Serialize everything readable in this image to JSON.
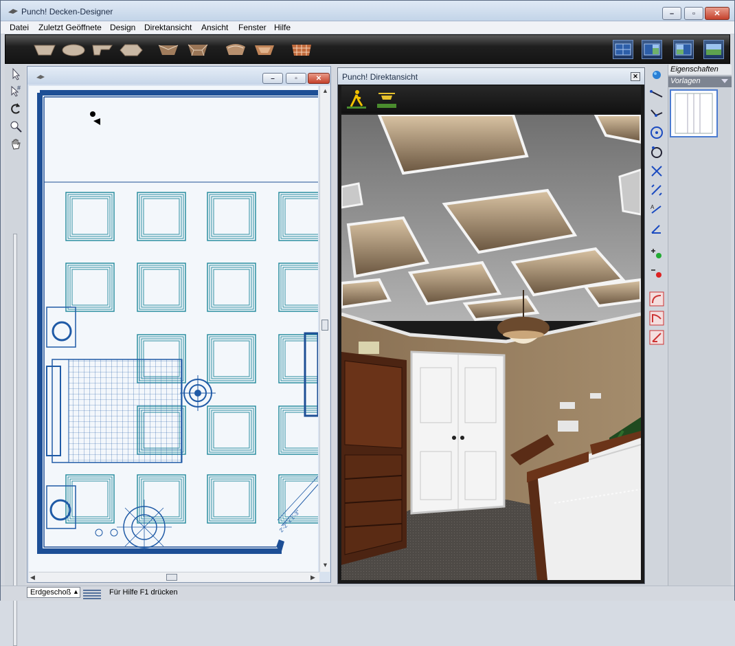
{
  "app": {
    "title": "Punch! Decken-Designer",
    "window_controls": {
      "minimize": "–",
      "maximize": "▫",
      "close": "✕"
    }
  },
  "menu": [
    "Datei",
    "Zuletzt Geöffnete",
    "Design",
    "Direktansicht",
    "Ansicht",
    "Fenster",
    "Hilfe"
  ],
  "toolbar": {
    "ceiling_tools": [
      "tray-ceiling-icon",
      "dome-ceiling-icon",
      "step-ceiling-icon",
      "hex-ceiling-icon",
      "pyramid-ceiling-icon",
      "hip-ceiling-icon",
      "barrel-ceiling-icon",
      "octagon-ceiling-icon",
      "coffer-grid-icon"
    ],
    "view_modes": [
      "plan-view-icon",
      "plan-3d-split-icon",
      "3d-plan-split-icon",
      "3d-view-icon"
    ]
  },
  "left_tools": [
    "select-arrow-icon",
    "select-grid-icon",
    "rotate-icon",
    "zoom-icon",
    "pan-hand-icon"
  ],
  "plan_window": {
    "controls": {
      "minimize": "–",
      "maximize": "▫",
      "close": "✕"
    }
  },
  "view_window": {
    "title": "Punch! Direktansicht",
    "close": "✕",
    "modes": [
      "walk-mode-icon",
      "fly-mode-icon"
    ]
  },
  "right_icons": [
    "sphere-icon",
    "line-icon",
    "polyline-icon",
    "circle-center-icon",
    "circle-icon",
    "cross-icon",
    "dimension-icon",
    "text-dimension-icon",
    "angle-dimension-icon",
    "add-point-icon",
    "remove-point-icon",
    "arc-tool-icon",
    "curve-tool-icon",
    "arc-corner-icon"
  ],
  "properties": {
    "tab1": "Eigenschaften",
    "tab2": "Vorlagen"
  },
  "status": {
    "floor": "Erdgeschoß",
    "help": "Für Hilfe F1 drücken"
  },
  "colors": {
    "plan_wall": "#1d4f96",
    "plan_line": "#2b8ea0",
    "ceiling_gray": "#8c8c8c",
    "wall_tan": "#9a8468",
    "wood": "#5a2c16"
  }
}
